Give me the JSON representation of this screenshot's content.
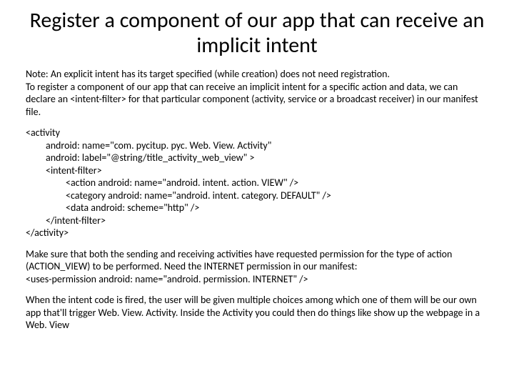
{
  "title": "Register a component of our app that can receive an implicit intent",
  "para1": "Note: An explicit intent has its target specified (while creation) does not need registration.",
  "para2": "To register a component of our app that can receive an implicit intent for a specific action and data, we can declare an <intent-filter> for that particular component (activity, service or a broadcast receiver) in our manifest file.",
  "code": {
    "l1": "<activity",
    "l2": "android: name=\"com. pycitup. pyc. Web. View. Activity\"",
    "l3": "android: label=\"@string/title_activity_web_view\" >",
    "l4": "<intent-filter>",
    "l5": "<action android: name=\"android. intent. action. VIEW\" />",
    "l6": "<category android: name=\"android. intent. category. DEFAULT\" />",
    "l7": "<data android: scheme=\"http\" />",
    "l8": "</intent-filter>",
    "l9": "</activity>"
  },
  "para3a": "Make sure that both the sending and receiving activities have requested permission for the type of action (ACTION_VIEW) to be performed. Need the INTERNET permission in our manifest:",
  "para3b": "<uses-permission android: name=\"android. permission. INTERNET\" />",
  "para4": "When the intent code  is fired, the user will be given multiple choices among which one of them will be our own app that'll trigger Web. View. Activity. Inside the Activity you could then do things like show up the webpage in a Web. View"
}
